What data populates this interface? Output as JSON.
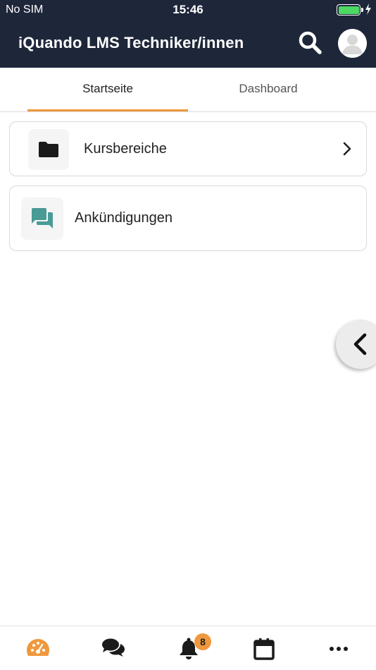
{
  "status_bar": {
    "carrier": "No SIM",
    "time": "15:46",
    "battery_level": 1.0
  },
  "header": {
    "title": "iQuando LMS Techniker/innen",
    "search_icon": "search-icon",
    "avatar_icon": "user-avatar-icon"
  },
  "tabs": [
    {
      "label": "Startseite",
      "active": true
    },
    {
      "label": "Dashboard",
      "active": false
    }
  ],
  "cards": [
    {
      "label": "Kursbereiche",
      "icon": "folder-icon",
      "icon_color": "#1b1b1b",
      "has_chevron": true
    },
    {
      "label": "Ankündigungen",
      "icon": "forum-icon",
      "icon_color": "#4a9a96",
      "has_chevron": false
    }
  ],
  "side_handle": {
    "icon": "chevron-left-icon"
  },
  "bottom_nav": {
    "items": [
      {
        "icon": "dashboard-gauge-icon",
        "active": true
      },
      {
        "icon": "chat-bubbles-icon",
        "active": false
      },
      {
        "icon": "bell-icon",
        "active": false,
        "badge": "8"
      },
      {
        "icon": "calendar-icon",
        "active": false
      },
      {
        "icon": "more-dots-icon",
        "active": false
      }
    ]
  },
  "colors": {
    "header_bg": "#1e273a",
    "accent": "#f0983d",
    "teal": "#4a9a96",
    "battery_fill": "#4cd964"
  }
}
